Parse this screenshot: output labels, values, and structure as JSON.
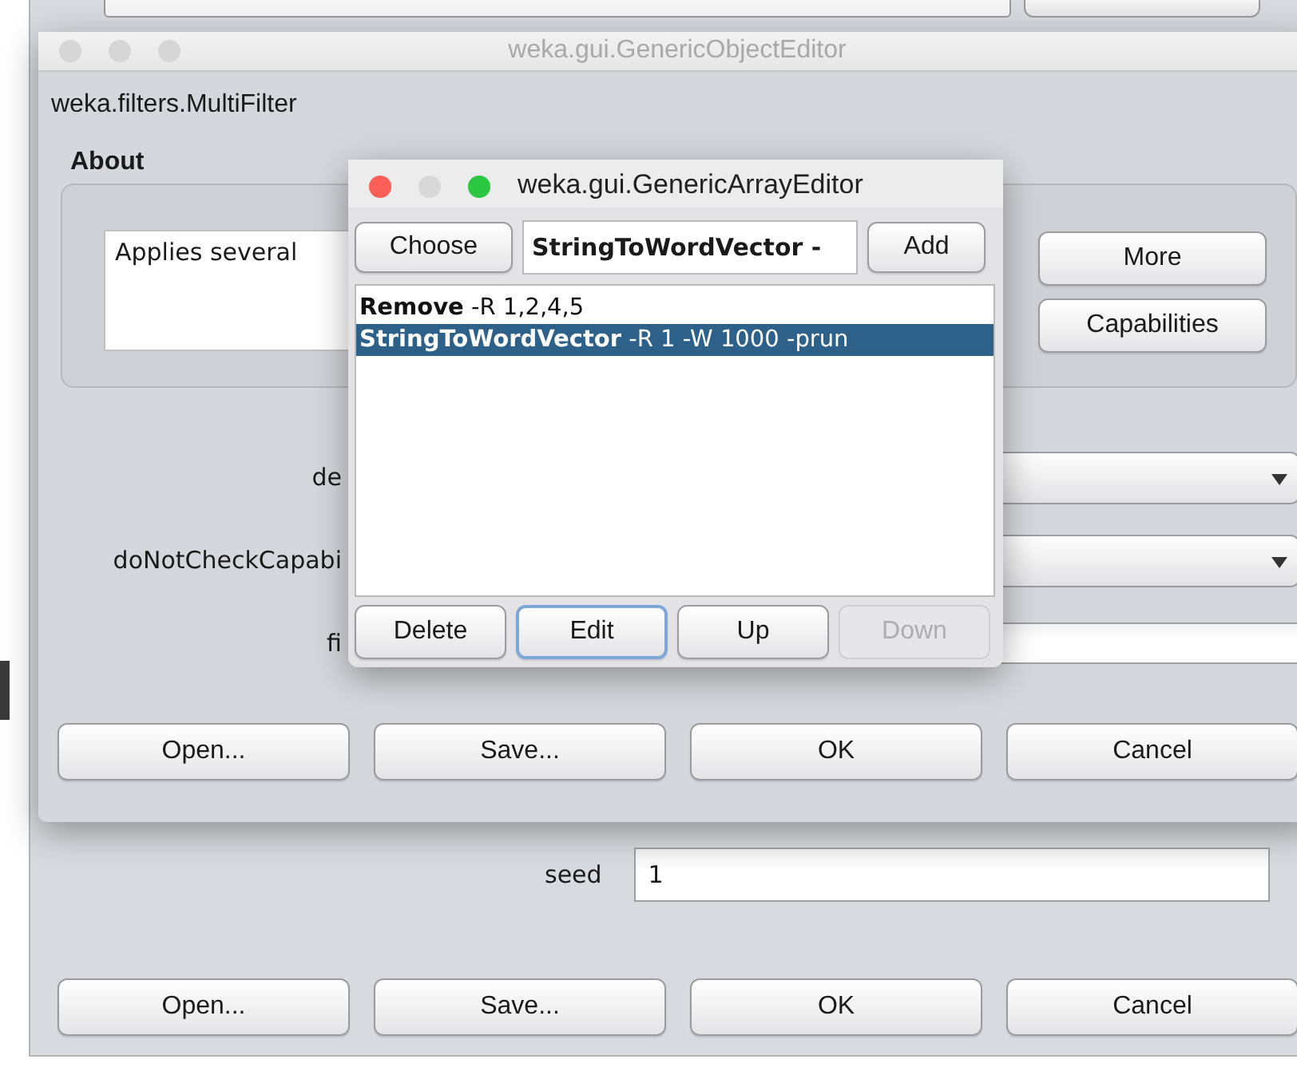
{
  "background_window": {
    "seed_label": "seed",
    "seed_value": "1",
    "buttons": [
      "Open...",
      "Save...",
      "OK",
      "Cancel"
    ]
  },
  "object_editor": {
    "title": "weka.gui.GenericObjectEditor",
    "active": false,
    "class_name": "weka.filters.MultiFilter",
    "about_heading": "About",
    "about_text": "Applies several",
    "side_buttons": [
      "More",
      "Capabilities"
    ],
    "properties": [
      {
        "label": "de",
        "kind": "dropdown"
      },
      {
        "label": "doNotCheckCapabi",
        "kind": "dropdown"
      },
      {
        "label": "fi",
        "kind": "text"
      }
    ],
    "buttons": [
      "Open...",
      "Save...",
      "OK",
      "Cancel"
    ]
  },
  "array_editor": {
    "title": "weka.gui.GenericArrayEditor",
    "active": true,
    "choose_button": "Choose",
    "class_field": "StringToWordVector -",
    "add_button": "Add",
    "items": [
      {
        "text": "**Remove** -R 1,2,4,5",
        "selected": false
      },
      {
        "text": "**StringToWordVector** -R 1 -W 1000 -prun",
        "selected": true
      }
    ],
    "buttons": [
      {
        "label": "Delete",
        "disabled": false,
        "focused": false
      },
      {
        "label": "Edit",
        "disabled": false,
        "focused": true
      },
      {
        "label": "Up",
        "disabled": false,
        "focused": false
      },
      {
        "label": "Down",
        "disabled": true,
        "focused": false
      }
    ]
  }
}
